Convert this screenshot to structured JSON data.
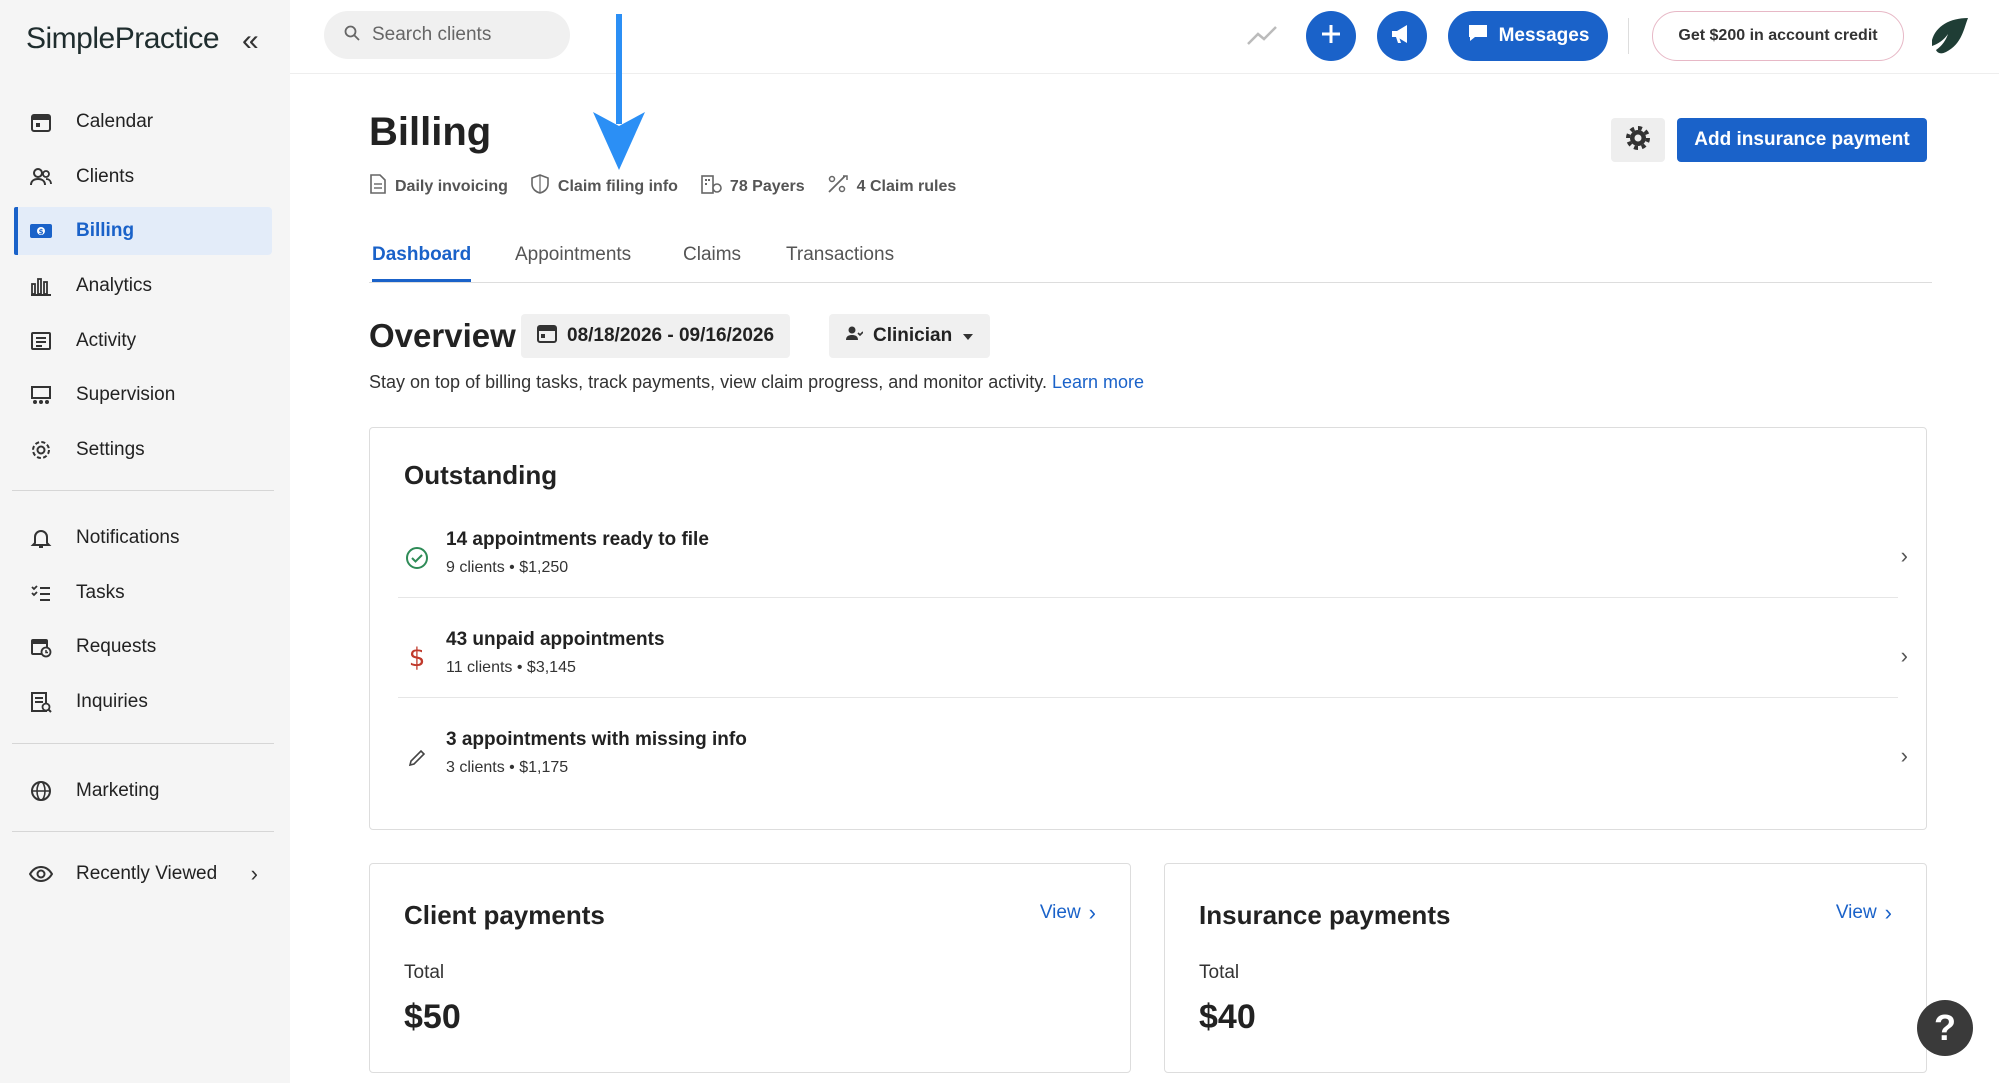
{
  "app": {
    "logo": "SimplePractice"
  },
  "sidebar": {
    "items": [
      {
        "label": "Calendar",
        "icon": "calendar-icon"
      },
      {
        "label": "Clients",
        "icon": "clients-icon"
      },
      {
        "label": "Billing",
        "icon": "billing-icon",
        "active": true
      },
      {
        "label": "Analytics",
        "icon": "analytics-icon"
      },
      {
        "label": "Activity",
        "icon": "activity-icon"
      },
      {
        "label": "Supervision",
        "icon": "supervision-icon"
      },
      {
        "label": "Settings",
        "icon": "settings-icon"
      },
      {
        "label": "Notifications",
        "icon": "bell-icon"
      },
      {
        "label": "Tasks",
        "icon": "tasks-icon"
      },
      {
        "label": "Requests",
        "icon": "requests-icon"
      },
      {
        "label": "Inquiries",
        "icon": "inquiries-icon"
      },
      {
        "label": "Marketing",
        "icon": "globe-icon"
      },
      {
        "label": "Recently Viewed",
        "icon": "eye-icon"
      }
    ]
  },
  "topbar": {
    "search_placeholder": "Search clients",
    "messages_label": "Messages",
    "credit_label": "Get $200 in account credit"
  },
  "billing": {
    "title": "Billing",
    "meta": {
      "daily_invoicing": "Daily invoicing",
      "claim_filing": "Claim filing info",
      "payers": "78 Payers",
      "claim_rules": "4 Claim rules"
    },
    "add_payment_label": "Add insurance payment",
    "tabs": [
      "Dashboard",
      "Appointments",
      "Claims",
      "Transactions"
    ]
  },
  "overview": {
    "title": "Overview",
    "date_range": "08/18/2026 - 09/16/2026",
    "clinician_label": "Clinician",
    "description": "Stay on top of billing tasks, track payments, view claim progress, and monitor activity.",
    "learn_more": "Learn more"
  },
  "outstanding": {
    "title": "Outstanding",
    "rows": [
      {
        "title": "14 appointments ready to file",
        "clients": "9 clients",
        "amount": "$1,250",
        "icon": "check-circle-icon",
        "color": "#2e8b57"
      },
      {
        "title": "43 unpaid appointments",
        "clients": "11 clients",
        "amount": "$3,145",
        "icon": "dollar-icon",
        "color": "#c0392b"
      },
      {
        "title": "3 appointments with missing info",
        "clients": "3 clients",
        "amount": "$1,175",
        "icon": "pencil-icon",
        "color": "#444444"
      }
    ],
    "separator": "•"
  },
  "client_payments": {
    "title": "Client payments",
    "view": "View",
    "total_label": "Total",
    "total": "$50"
  },
  "insurance_payments": {
    "title": "Insurance payments",
    "view": "View",
    "total_label": "Total",
    "total": "$40"
  },
  "help_label": "?",
  "colors": {
    "accent": "#1a62c9",
    "annotation_arrow": "#2b8ff5"
  }
}
